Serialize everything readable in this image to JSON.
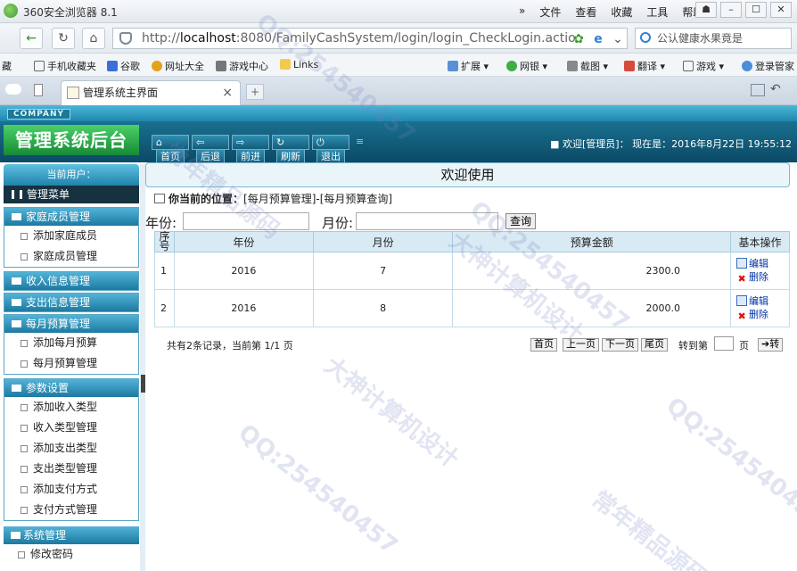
{
  "browser": {
    "app_title": "360安全浏览器 8.1",
    "menu": [
      "文件",
      "查看",
      "收藏",
      "工具",
      "帮助"
    ],
    "url_scheme": "http://",
    "url_host": "localhost",
    "url_rest": ":8080/FamilyCashSystem/login/login_CheckLogin.actio",
    "search_text": "公认健康水果竟是",
    "favorites": [
      "藏",
      "手机收藏夹",
      "谷歌",
      "网址大全",
      "游戏中心",
      "Links",
      "扩展",
      "网银",
      "截图",
      "翻译",
      "游戏",
      "登录管家"
    ],
    "tab_title": "管理系统主界面",
    "tab_close": "×",
    "new_tab": "+"
  },
  "header": {
    "company": "COMPANY",
    "title": "管理系统后台",
    "nav": [
      "首页",
      "后退",
      "前进",
      "刷新",
      "退出"
    ],
    "welcome": "欢迎[管理员]",
    "time_label": "现在是：",
    "time": "2016年8月22日 19:55:12"
  },
  "sidebar": {
    "current_user": "当前用户：",
    "root": "管理菜单",
    "groups": [
      {
        "title": "家庭成员管理",
        "items": [
          "添加家庭成员",
          "家庭成员管理"
        ]
      },
      {
        "title": "收入信息管理",
        "items": []
      },
      {
        "title": "支出信息管理",
        "items": []
      },
      {
        "title": "每月预算管理",
        "items": [
          "添加每月预算",
          "每月预算管理"
        ]
      },
      {
        "title": "参数设置",
        "items": [
          "添加收入类型",
          "收入类型管理",
          "添加支出类型",
          "支出类型管理",
          "添加支付方式",
          "支付方式管理"
        ]
      },
      {
        "title": "系统管理",
        "items": [
          "修改密码"
        ]
      }
    ]
  },
  "main": {
    "welcome": "欢迎使用",
    "location_label": "你当前的位置：",
    "location": "[每月预算管理]-[每月预算查询]",
    "filter": {
      "year_label": "年份:",
      "month_label": "月份:",
      "search_button": "查询",
      "year_value": "",
      "month_value": ""
    },
    "table": {
      "headers": [
        "序号",
        "年份",
        "月份",
        "预算金额",
        "基本操作"
      ],
      "rows": [
        {
          "no": "1",
          "year": "2016",
          "month": "7",
          "amount": "2300.0"
        },
        {
          "no": "2",
          "year": "2016",
          "month": "8",
          "amount": "2000.0"
        }
      ],
      "edit_label": "编辑",
      "delete_label": "删除"
    },
    "pager": {
      "info": "共有2条记录，当前第 1/1 页",
      "first": "首页",
      "prev": "上一页",
      "next": "下一页",
      "last": "尾页",
      "goto_label": "转到第",
      "page_suffix": "页",
      "go_button": "转",
      "goto_value": ""
    }
  },
  "watermark": {
    "qq": "QQ:254540457",
    "text1": "大神计算机设计",
    "text2": "常年精品源码"
  }
}
